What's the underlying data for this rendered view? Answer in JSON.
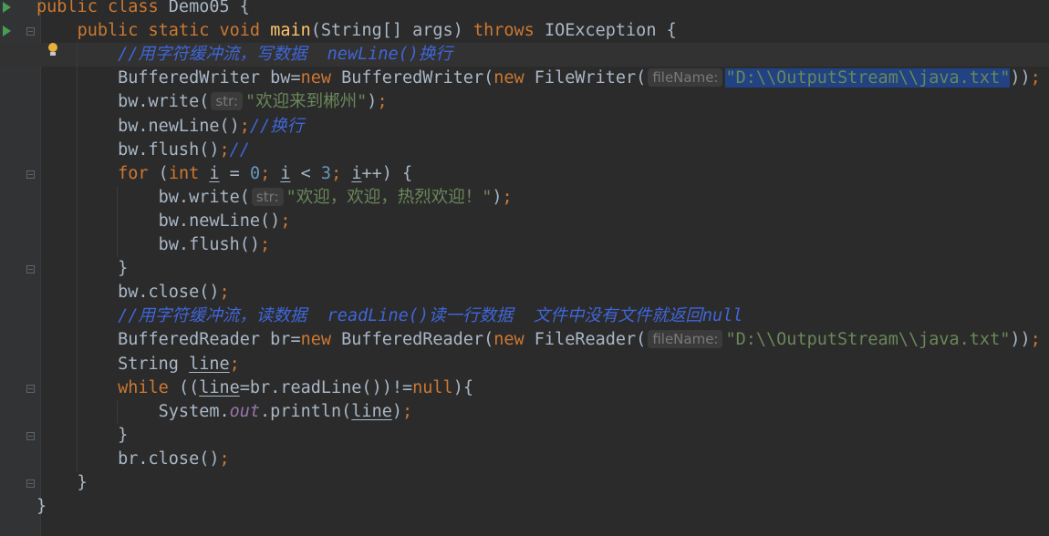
{
  "editor": {
    "lines": [
      [
        {
          "t": "public class ",
          "c": "kw"
        },
        {
          "t": "Demo05 {",
          "c": "p"
        }
      ],
      [
        {
          "t": "    "
        },
        {
          "t": "public static void ",
          "c": "kw"
        },
        {
          "t": "main",
          "c": "fn"
        },
        {
          "t": "(String[] args) ",
          "c": "p"
        },
        {
          "t": "throws ",
          "c": "kw"
        },
        {
          "t": "IOException {",
          "c": "p"
        }
      ],
      [
        {
          "t": "        "
        },
        {
          "t": "//用字符缓冲流，写数据  newLine()换行",
          "c": "cmt"
        }
      ],
      [
        {
          "t": "        BufferedWriter bw="
        },
        {
          "t": "new ",
          "c": "kw"
        },
        {
          "t": "BufferedWriter("
        },
        {
          "t": "new ",
          "c": "kw"
        },
        {
          "t": "FileWriter("
        },
        {
          "hint": "fileName:"
        },
        {
          "t": "\"D:\\\\OutputStream\\\\java.txt\"",
          "c": "str sel"
        },
        {
          "t": "))"
        },
        {
          "t": ";",
          "c": "kw"
        }
      ],
      [
        {
          "t": "        bw.write("
        },
        {
          "hint": "str:"
        },
        {
          "t": "\"欢迎来到郴州\"",
          "c": "str"
        },
        {
          "t": ")"
        },
        {
          "t": ";",
          "c": "kw"
        }
      ],
      [
        {
          "t": "        bw.newLine()"
        },
        {
          "t": ";",
          "c": "kw"
        },
        {
          "t": "//换行",
          "c": "cmt"
        }
      ],
      [
        {
          "t": "        bw.flush()"
        },
        {
          "t": ";",
          "c": "kw"
        },
        {
          "t": "//",
          "c": "cmt"
        }
      ],
      [
        {
          "t": "        "
        },
        {
          "t": "for ",
          "c": "kw"
        },
        {
          "t": "("
        },
        {
          "t": "int ",
          "c": "kw"
        },
        {
          "t": "i",
          "c": "ul"
        },
        {
          "t": " = "
        },
        {
          "t": "0",
          "c": "num"
        },
        {
          "t": "; ",
          "c": "kw"
        },
        {
          "t": "i",
          "c": "ul"
        },
        {
          "t": " < "
        },
        {
          "t": "3",
          "c": "num"
        },
        {
          "t": "; ",
          "c": "kw"
        },
        {
          "t": "i",
          "c": "ul"
        },
        {
          "t": "++) {"
        }
      ],
      [
        {
          "t": "            bw.write("
        },
        {
          "hint": "str:"
        },
        {
          "t": "\"欢迎，欢迎，热烈欢迎！\"",
          "c": "str"
        },
        {
          "t": ")"
        },
        {
          "t": ";",
          "c": "kw"
        }
      ],
      [
        {
          "t": "            bw.newLine()"
        },
        {
          "t": ";",
          "c": "kw"
        }
      ],
      [
        {
          "t": "            bw.flush()"
        },
        {
          "t": ";",
          "c": "kw"
        }
      ],
      [
        {
          "t": "        }"
        }
      ],
      [
        {
          "t": "        bw.close()"
        },
        {
          "t": ";",
          "c": "kw"
        }
      ],
      [
        {
          "t": "        "
        },
        {
          "t": "//用字符缓冲流，读数据  readLine()读一行数据  文件中没有文件就返回null",
          "c": "cmt"
        }
      ],
      [
        {
          "t": "        BufferedReader br="
        },
        {
          "t": "new ",
          "c": "kw"
        },
        {
          "t": "BufferedReader("
        },
        {
          "t": "new ",
          "c": "kw"
        },
        {
          "t": "FileReader("
        },
        {
          "hint": "fileName:"
        },
        {
          "t": "\"D:\\\\OutputStream\\\\java.txt\"",
          "c": "str"
        },
        {
          "t": "))"
        },
        {
          "t": ";",
          "c": "kw"
        }
      ],
      [
        {
          "t": "        String "
        },
        {
          "t": "line",
          "c": "ul"
        },
        {
          "t": ";",
          "c": "kw"
        }
      ],
      [
        {
          "t": "        "
        },
        {
          "t": "while ",
          "c": "kw"
        },
        {
          "t": "(("
        },
        {
          "t": "line",
          "c": "ul"
        },
        {
          "t": "=br.readLine())!="
        },
        {
          "t": "null",
          "c": "kw"
        },
        {
          "t": "){"
        }
      ],
      [
        {
          "t": "            System."
        },
        {
          "t": "out",
          "c": "fld"
        },
        {
          "t": ".println("
        },
        {
          "t": "line",
          "c": "ul"
        },
        {
          "t": ")"
        },
        {
          "t": ";",
          "c": "kw"
        }
      ],
      [
        {
          "t": "        }"
        }
      ],
      [
        {
          "t": "        br.close()"
        },
        {
          "t": ";",
          "c": "kw"
        }
      ],
      [
        {
          "t": "    }"
        }
      ],
      [
        {
          "t": "}"
        }
      ]
    ]
  },
  "gutter": {
    "run_icon_lines": [
      0,
      1
    ],
    "fold_start_lines": [
      1,
      7,
      16
    ],
    "fold_end_lines": [
      11,
      18,
      20
    ],
    "intention_bulb_line": 2
  },
  "colors": {
    "background": "#2b2b2b",
    "keyword": "#cc7832",
    "method": "#ffc66d",
    "string": "#6a8759",
    "number": "#6897bb",
    "comment": "#3f66d8",
    "selection": "#214283"
  }
}
